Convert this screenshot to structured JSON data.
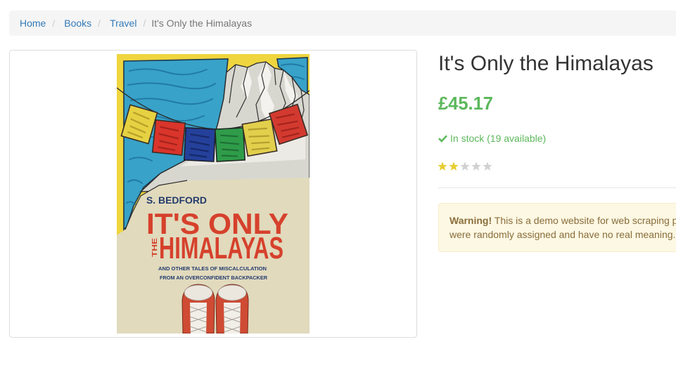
{
  "breadcrumb": {
    "separator": "/",
    "items": [
      {
        "label": "Home"
      },
      {
        "label": "Books"
      },
      {
        "label": "Travel"
      },
      {
        "label": "It's Only the Himalayas"
      }
    ]
  },
  "product": {
    "title": "It's Only the Himalayas",
    "price": "£45.17",
    "availability": "In stock (19 available)",
    "availability_icon": "check-icon",
    "rating": {
      "value": 2,
      "max": 5,
      "icon": "star-icon"
    },
    "cover": {
      "author": "S. BEDFORD",
      "title_line1": "IT'S ONLY",
      "title_small": "THE",
      "title_line2": "HIMALAYAS",
      "subtitle_line1": "AND OTHER TALES OF MISCALCULATION",
      "subtitle_line2": "FROM AN OVERCONFIDENT BACKPACKER"
    }
  },
  "alert": {
    "label": "Warning!",
    "line1": "This is a demo website for web scraping p",
    "line2": "were randomly assigned and have no real meaning."
  },
  "colors": {
    "link": "#337ab7",
    "price": "#5cb85c",
    "in_stock": "#5cb85c",
    "star_filled": "#e6ce31",
    "star_empty": "#d1d1d1",
    "alert_background": "#fcf8e3",
    "alert_text": "#8a6d3b"
  }
}
